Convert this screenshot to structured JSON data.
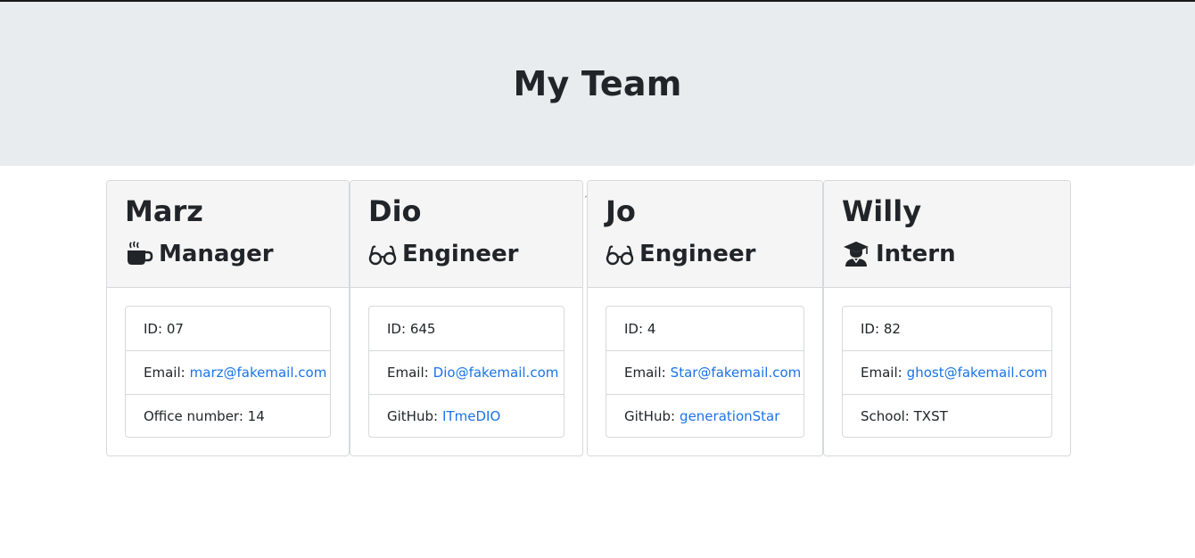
{
  "header": {
    "title": "My Team"
  },
  "cards": [
    {
      "name": "Marz",
      "role": "Manager",
      "icon": "mug-icon",
      "id_label": "ID:",
      "id_value": "07",
      "email_label": "Email:",
      "email": "marz@fakemail.com",
      "extra_label": "Office number:",
      "extra_value": "14"
    },
    {
      "name": "Dio",
      "role": "Engineer",
      "icon": "glasses-icon",
      "id_label": "ID:",
      "id_value": "645",
      "email_label": "Email:",
      "email": "Dio@fakemail.com",
      "extra_label": "GitHub:",
      "extra_value": "ITmeDIO"
    },
    {
      "name": "Jo",
      "role": "Engineer",
      "icon": "glasses-icon",
      "id_label": "ID:",
      "id_value": "4",
      "email_label": "Email:",
      "email": "Star@fakemail.com",
      "extra_label": "GitHub:",
      "extra_value": "generationStar"
    },
    {
      "name": "Willy",
      "role": "Intern",
      "icon": "graduate-icon",
      "id_label": "ID:",
      "id_value": "82",
      "email_label": "Email:",
      "email": "ghost@fakemail.com",
      "extra_label": "School:",
      "extra_value": "TXST"
    }
  ],
  "colors": {
    "header_bg": "#e9ecef",
    "card_header_bg": "#f5f5f5",
    "link": "#1a73e8",
    "text": "#212529",
    "border": "#d6d9dc"
  }
}
